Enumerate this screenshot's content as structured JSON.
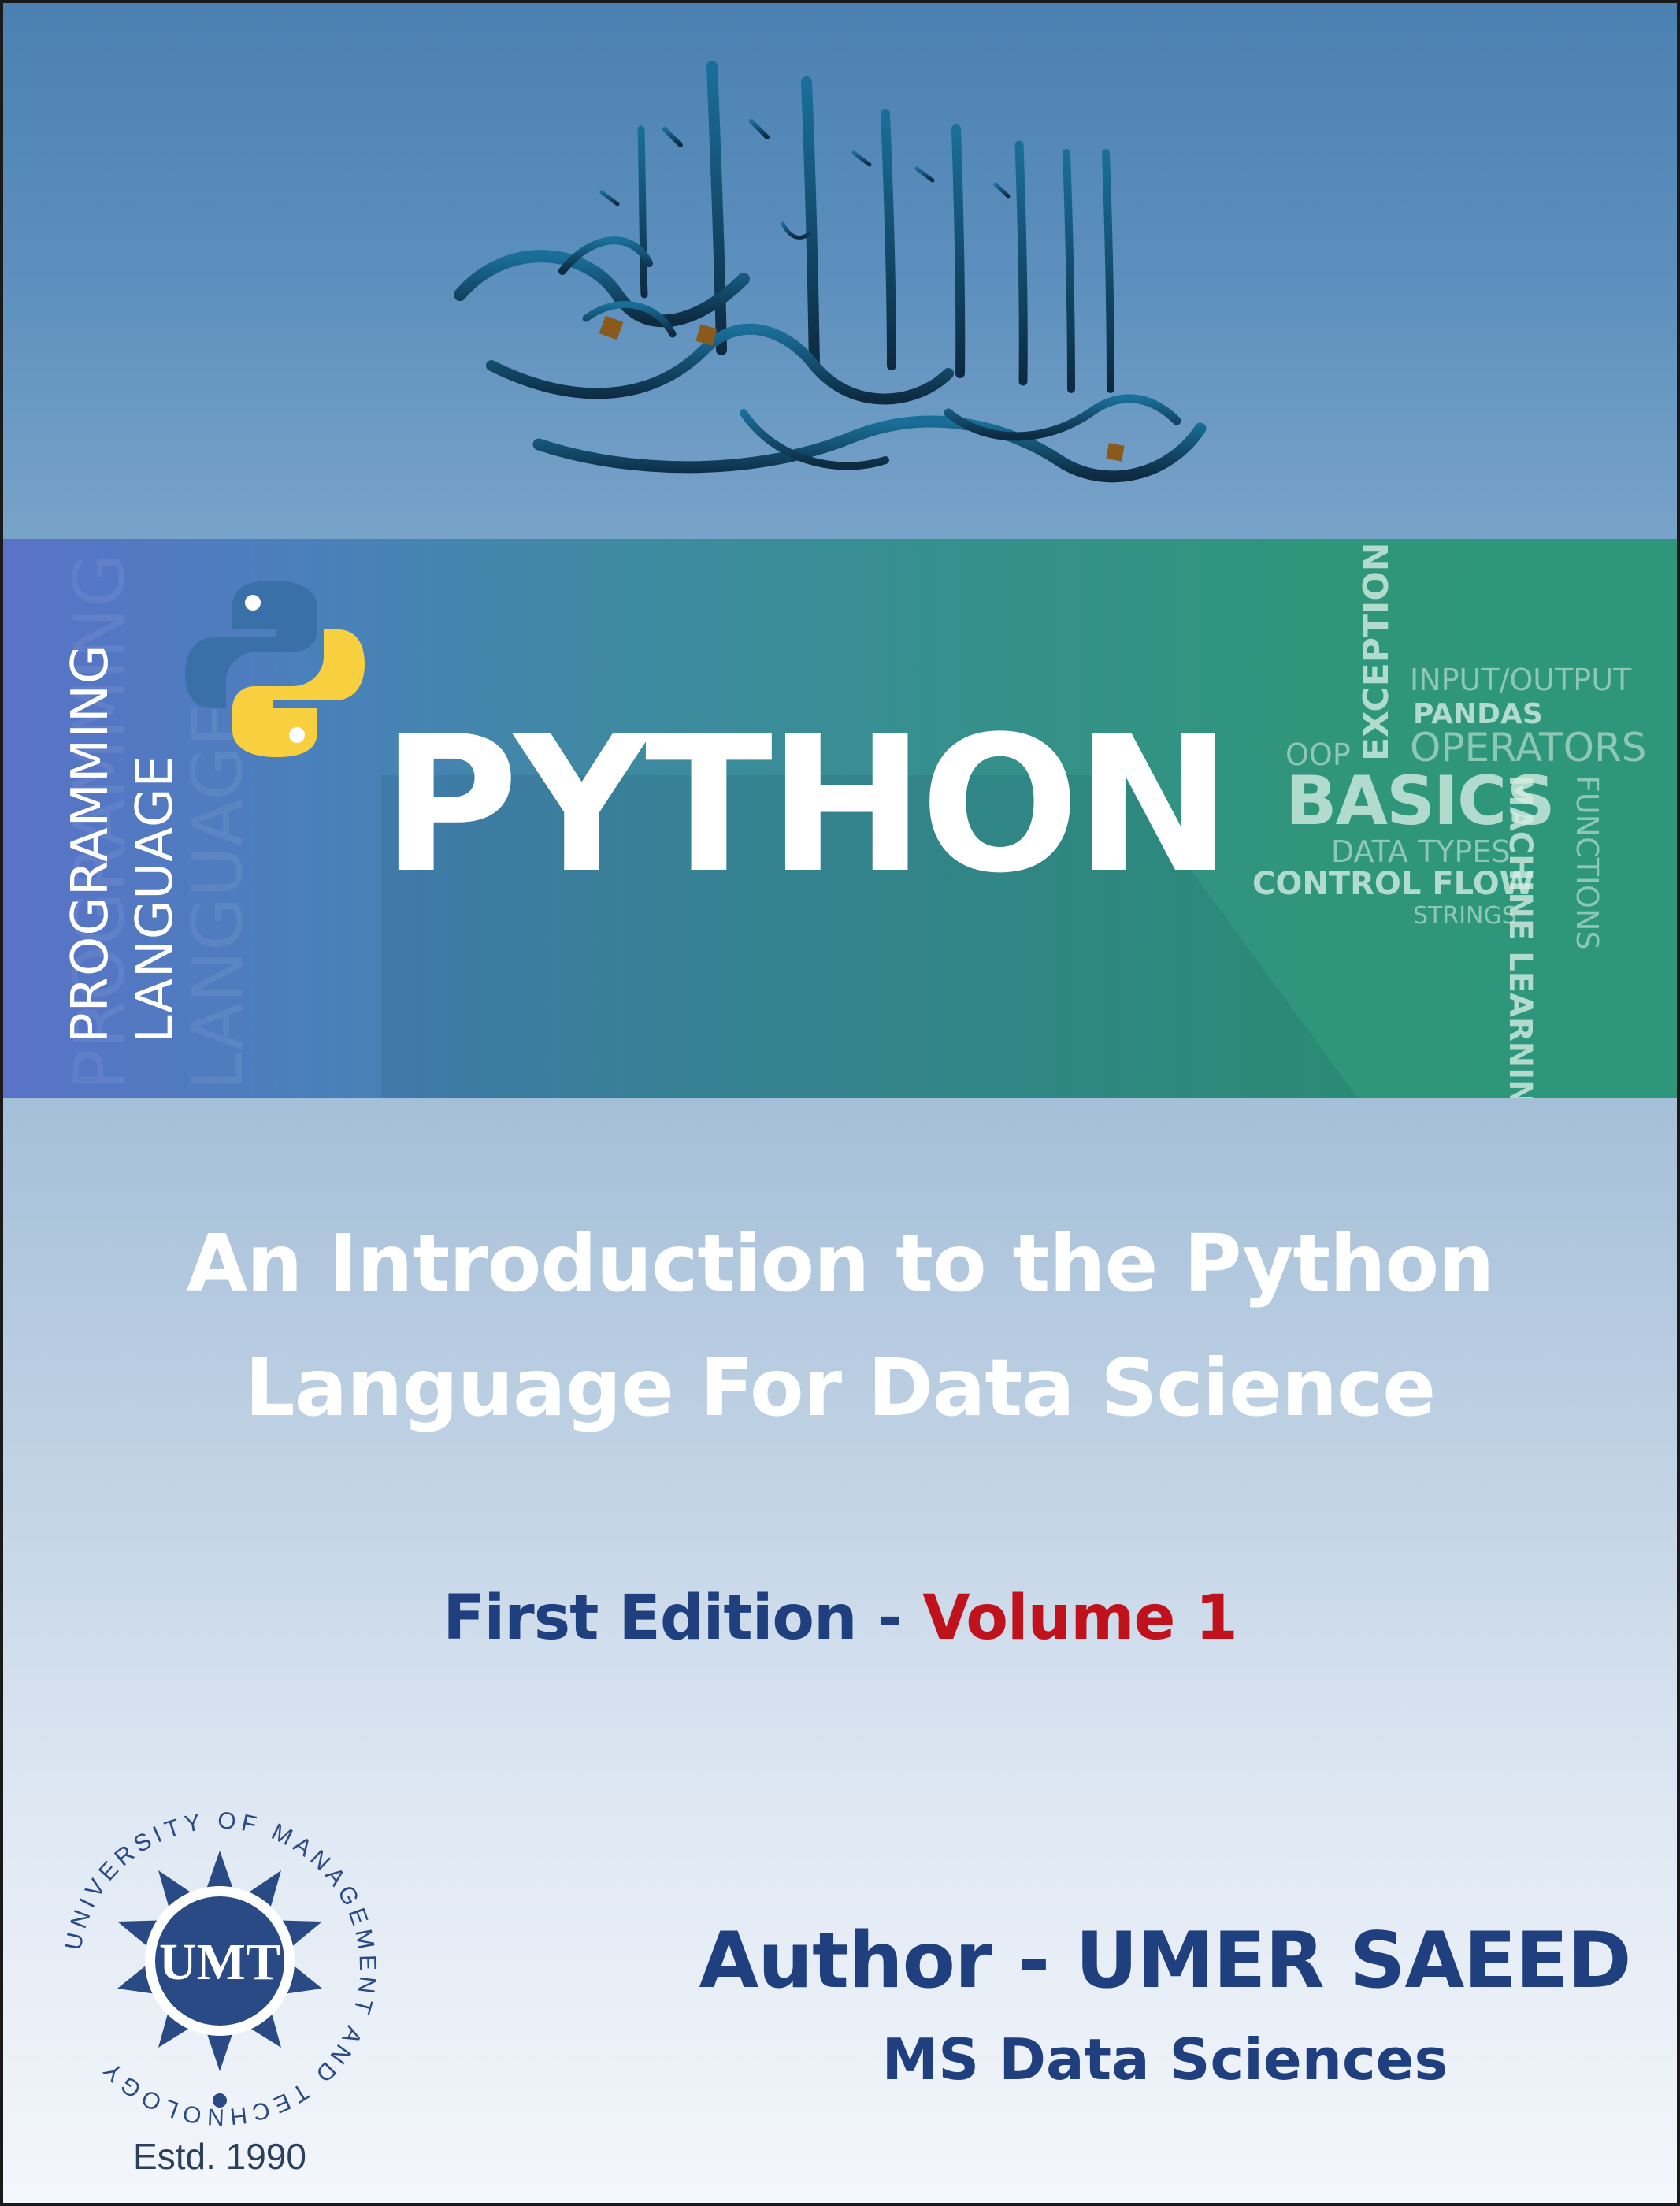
{
  "banner": {
    "vertical_label_line1": "PROGRAMMING",
    "vertical_label_line2": "LANGUAGE",
    "title": "PYTHON",
    "tags": {
      "exception": "EXCEPTION",
      "input_output": "INPUT/OUTPUT",
      "pandas": "PANDAS",
      "oop": "OOP",
      "operators": "OPERATORS",
      "basics": "BASICS",
      "machine_learning": "MACHINE LEARNING",
      "functions": "FUNCTIONS",
      "data_types": "DATA TYPES",
      "control_flow": "CONTROL FLOW",
      "strings": "STRINGS"
    }
  },
  "book": {
    "title_line1": "An Introduction to the Python",
    "title_line2": "Language For Data Science",
    "edition_prefix": "First Edition - ",
    "edition_volume": "Volume 1",
    "author": "Author - UMER SAEED",
    "degree": "MS Data Sciences"
  },
  "university": {
    "seal_ring_text": "UNIVERSITY OF MANAGEMENT AND TECHNOLOGY",
    "seal_abbrev": "UMT",
    "established": "Estd. 1990"
  },
  "colors": {
    "navy": "#1f3f7f",
    "volume_red": "#c0121c",
    "python_blue": "#3a70a8",
    "python_yellow": "#f7cf3f"
  }
}
